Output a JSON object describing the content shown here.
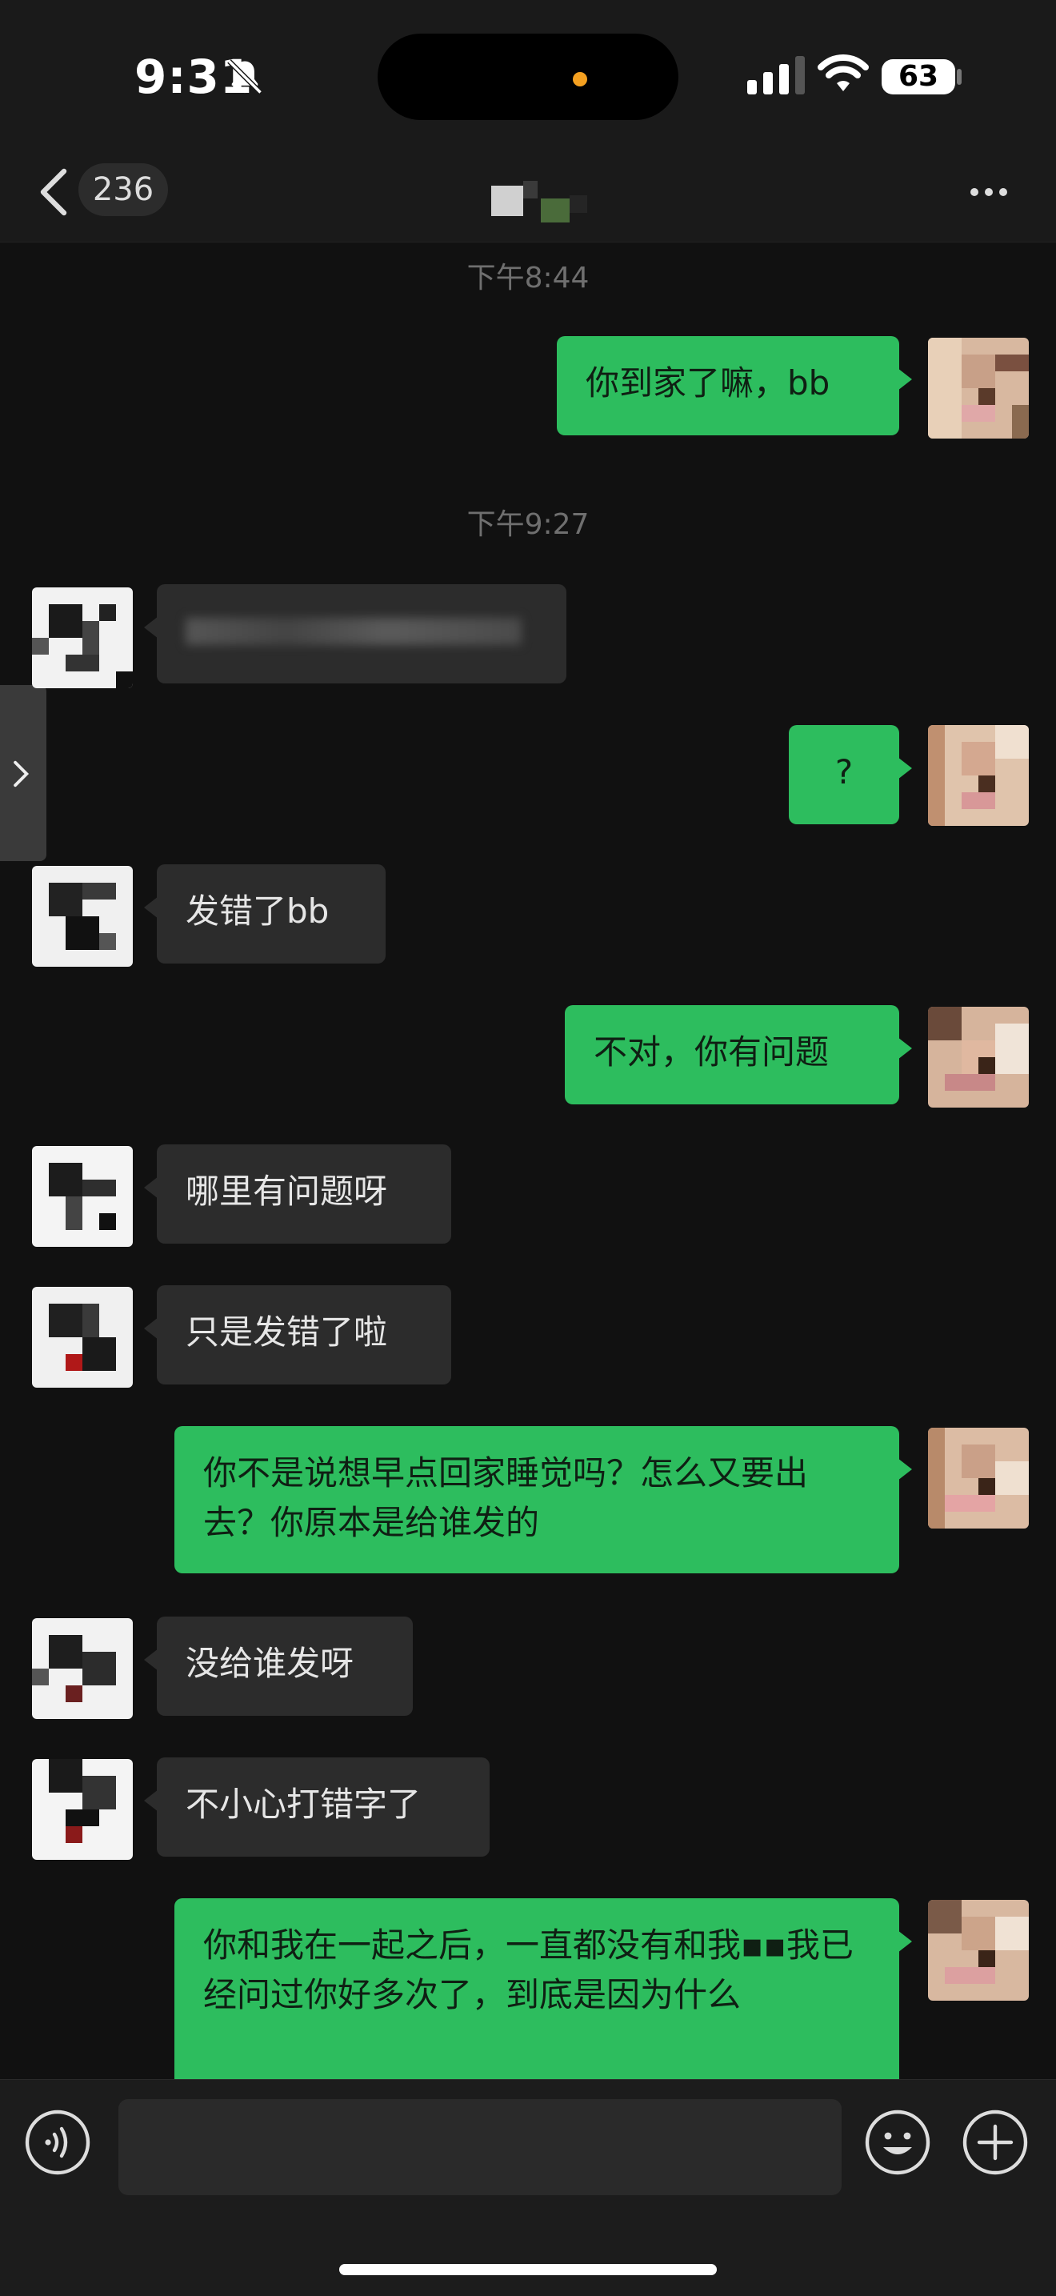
{
  "status": {
    "time": "9:31",
    "battery": "63"
  },
  "nav": {
    "unread_count": "236",
    "contact_name": ""
  },
  "messages": [
    {
      "type": "time",
      "text": "下午8:44"
    },
    {
      "type": "out",
      "text": "你到家了嘛，bb"
    },
    {
      "type": "time",
      "text": "下午9:27"
    },
    {
      "type": "in",
      "text": ""
    },
    {
      "type": "out",
      "text": "?"
    },
    {
      "type": "in",
      "text": "发错了bb"
    },
    {
      "type": "out",
      "text": "不对，你有问题"
    },
    {
      "type": "in",
      "text": "哪里有问题呀"
    },
    {
      "type": "in",
      "text": "只是发错了啦"
    },
    {
      "type": "out",
      "text": "你不是说想早点回家睡觉吗？怎么又要出去？你原本是给谁发的"
    },
    {
      "type": "in",
      "text": "没给谁发呀"
    },
    {
      "type": "in",
      "text": "不小心打错字了"
    },
    {
      "type": "out",
      "text": "你和我在一起之后，一直都没有和我▪▪我已经问过你好多次了，到底是因为什么"
    }
  ],
  "input": {
    "placeholder": ""
  },
  "icons": {
    "bell": "bell-slash-icon",
    "back": "chevron-left-icon",
    "more": "more-icon",
    "voice": "voice-icon",
    "emoji": "emoji-icon",
    "plus": "plus-icon",
    "side": "chevron-right-icon"
  },
  "colors": {
    "bubble_out": "#2dbd5e",
    "bubble_in": "#2c2c2c",
    "background": "#111111"
  }
}
